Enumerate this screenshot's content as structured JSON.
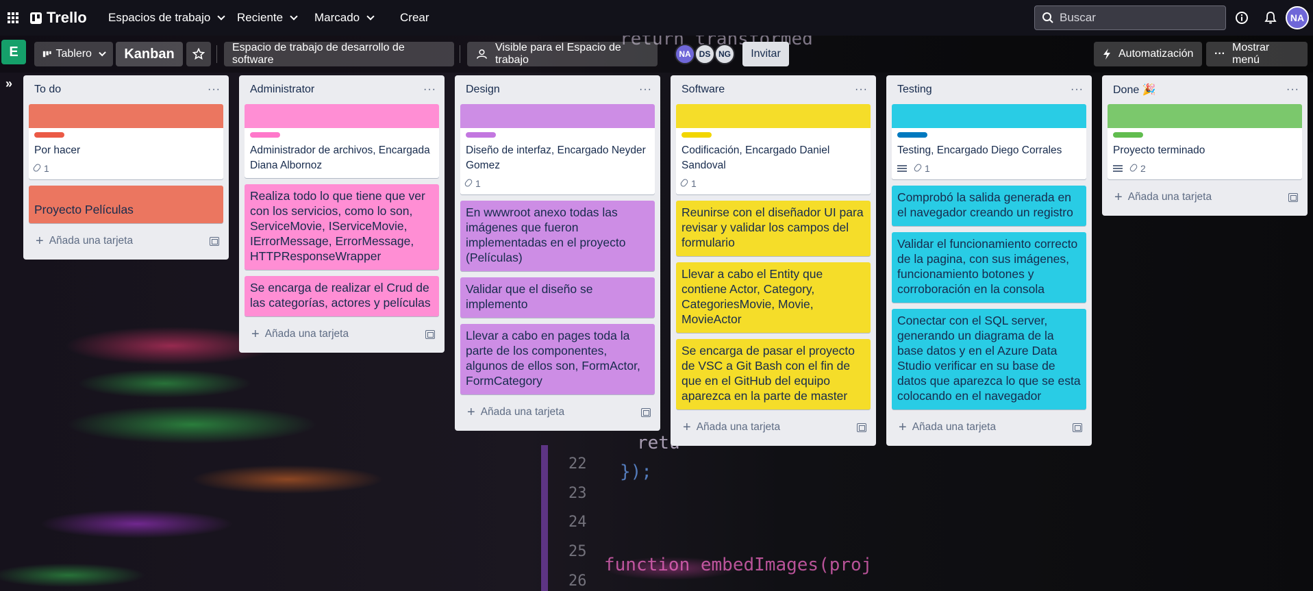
{
  "topbar": {
    "logo": "Trello",
    "menu": [
      "Espacios de trabajo",
      "Reciente",
      "Marcado"
    ],
    "create_label": "Crear",
    "search_placeholder": "Buscar",
    "user_initials": "NA"
  },
  "boardbar": {
    "workspace_letter": "E",
    "view_label": "Tablero",
    "board_name": "Kanban",
    "workspace_name": "Espacio de trabajo de desarrollo de software",
    "visibility_label": "Visible para el Espacio de trabajo",
    "members": [
      {
        "initials": "NA",
        "color": "#6f67d8"
      },
      {
        "initials": "DS",
        "color": "#dfe1e6"
      },
      {
        "initials": "NG",
        "color": "#dfe1e6"
      }
    ],
    "invite_label": "Invitar",
    "automation_label": "Automatización",
    "menu_label": "Mostrar menú"
  },
  "add_card_label": "Añada una tarjeta",
  "lists": [
    {
      "title": "To do",
      "color": "#eb7660",
      "label_color": "#eb5a46",
      "first_card": {
        "title": "Por hacer",
        "attachments": "1",
        "has_description": false
      },
      "cards": [
        "Proyecto Películas"
      ]
    },
    {
      "title": "Administrator",
      "color": "#ff8ed4",
      "label_color": "#ff78cb",
      "first_card": {
        "title": "Administrador de archivos, Encargada Diana Albornoz",
        "attachments": "",
        "has_description": false
      },
      "cards": [
        "Realiza todo lo que tiene que ver con los servicios, como lo son, ServiceMovie, IServiceMovie, IErrorMessage, ErrorMessage, HTTPResponseWrapper",
        "Se encarga de realizar el Crud de las categorías, actores y películas"
      ]
    },
    {
      "title": "Design",
      "color": "#cd8de5",
      "label_color": "#c377e0",
      "first_card": {
        "title": "Diseño de interfaz, Encargado Neyder Gomez",
        "attachments": "1",
        "has_description": false
      },
      "cards": [
        "En wwwroot anexo todas las imágenes que fueron implementadas en el proyecto (Películas)",
        "Validar que el diseño se implemento",
        "Llevar a cabo en pages toda la parte de los componentes, algunos de ellos son, FormActor, FormCategory"
      ]
    },
    {
      "title": "Software",
      "color": "#f5dd29",
      "label_color": "#f2d600",
      "first_card": {
        "title": "Codificación, Encargado Daniel Sandoval",
        "attachments": "1",
        "has_description": false
      },
      "cards": [
        "Reunirse con el diseñador UI para revisar y validar los campos del formulario",
        "Llevar a cabo el Entity que contiene Actor, Category, CategoriesMovie, Movie, MovieActor",
        "Se encarga de pasar el proyecto de VSC a Git Bash con el fin de que en el GitHub del equipo aparezca en la parte de master"
      ]
    },
    {
      "title": "Testing",
      "color": "#29cce5",
      "label_color": "#0079bf",
      "first_card": {
        "title": "Testing, Encargado Diego Corrales",
        "attachments": "1",
        "has_description": true
      },
      "cards": [
        "Comprobó la salida generada en el navegador creando un registro",
        "Validar el funcionamiento correcto de la pagina, con sus imágenes, funcionamiento botones y corroboración en la consola",
        "Conectar con el SQL server, generando un diagrama de la base datos y en el Azure Data Studio verificar en su base de datos que aparezca lo que se esta colocando en el navegador"
      ]
    },
    {
      "title": "Done 🎉",
      "color": "#7bc86c",
      "label_color": "#61bd4f",
      "first_card": {
        "title": "Proyecto terminado",
        "attachments": "2",
        "has_description": true
      },
      "cards": []
    }
  ],
  "background_code": [
    "return transformed",
    "retu",
    "});",
    "function embedImages(proj"
  ],
  "background_line_numbers": [
    "22",
    "23",
    "24",
    "25",
    "26"
  ]
}
